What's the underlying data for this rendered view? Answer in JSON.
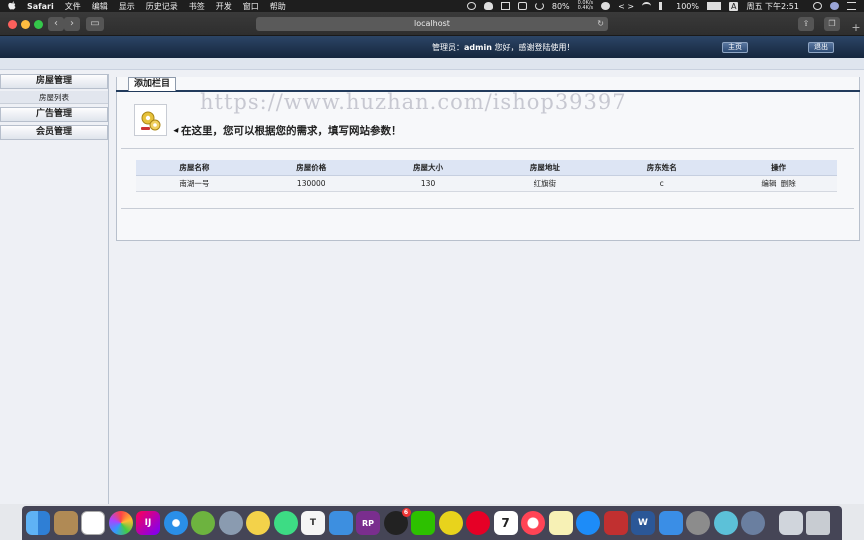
{
  "menubar": {
    "apple": "",
    "items": [
      "Safari",
      "文件",
      "编辑",
      "显示",
      "历史记录",
      "书签",
      "开发",
      "窗口",
      "帮助"
    ],
    "battery": "80%",
    "net_up": "0.0K/s",
    "net_down": "0.4K/s",
    "battery2": "100%",
    "input": "A",
    "clock": "周五 下午2:51"
  },
  "browser": {
    "address": "localhost",
    "back_icon": "chevron-left-icon",
    "forward_icon": "chevron-right-icon"
  },
  "header": {
    "welcome_prefix": "管理员：",
    "admin": "admin",
    "welcome_suffix": " 您好，感谢登陆使用！",
    "home_label": "主页",
    "exit_label": "退出"
  },
  "sidebar": {
    "sections": [
      {
        "label": "房屋管理",
        "subitems": [
          "房屋列表"
        ]
      },
      {
        "label": "广告管理"
      },
      {
        "label": "会员管理"
      }
    ]
  },
  "main": {
    "tab_title": "添加栏目",
    "intro": "在这里，您可以根据您的需求，填写网站参数！",
    "table": {
      "headers": [
        "房屋名称",
        "房屋价格",
        "房屋大小",
        "房屋地址",
        "房东姓名",
        "操作"
      ],
      "rows": [
        {
          "name": "南湖一号",
          "price": "130000",
          "size": "130",
          "address": "红旗街",
          "owner": "c",
          "edit": "编辑",
          "delete": "删除"
        }
      ]
    }
  },
  "watermark": "https://www.huzhan.com/ishop39397",
  "colors": {
    "header_dark": "#15263d",
    "table_header": "#dde5f4",
    "page_bg": "#eef0f5"
  },
  "dock": {
    "icons": [
      "finder-icon",
      "notes-icon",
      "reminders-icon",
      "photos-icon",
      "intellij-icon",
      "safari-icon",
      "spring-icon",
      "launchpad-icon",
      "duck-icon",
      "android-icon",
      "textedit-icon",
      "xcode-icon",
      "axure-icon",
      "qq-icon",
      "wechat-icon",
      "lemon-icon",
      "netease-music-icon",
      "calendar-icon",
      "itunes-icon",
      "stickies-icon",
      "appstore-icon",
      "remote-desktop-icon",
      "word-icon",
      "keynote-icon",
      "system-prefs-icon",
      "fan-icon",
      "network-icon",
      "preview-icon",
      "trash-icon"
    ],
    "calendar_day": "7",
    "qq_badge": "6",
    "axure_label": "RP",
    "word_label": "W",
    "textedit_label": "T"
  }
}
